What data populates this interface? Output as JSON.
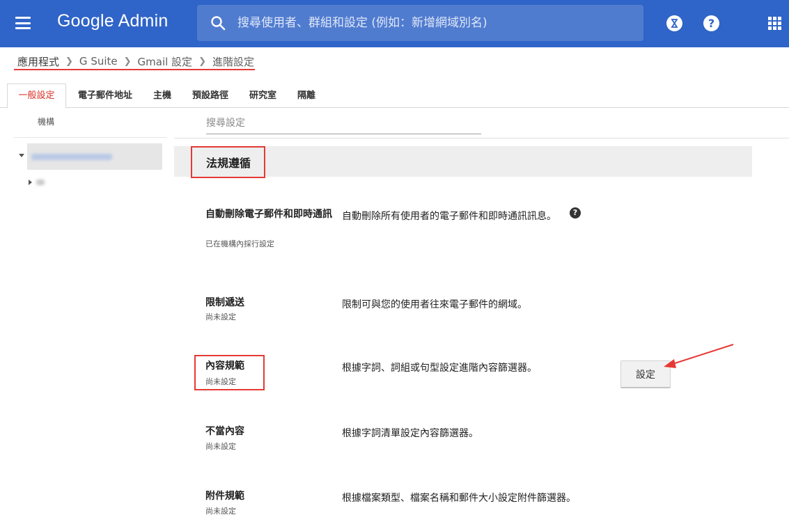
{
  "header": {
    "app_title": "Google Admin",
    "search_placeholder": "搜尋使用者、群組和設定 (例如：新增網域別名)",
    "icons": [
      "menu-icon",
      "search-icon",
      "hourglass-icon",
      "help-icon",
      "apps-grid-icon"
    ],
    "help_glyph": "?",
    "background_color": "#2f64c8"
  },
  "breadcrumb": [
    "應用程式",
    "G Suite",
    "Gmail 設定",
    "進階設定"
  ],
  "tabs": [
    {
      "label": "一般設定",
      "active": true
    },
    {
      "label": "電子郵件地址"
    },
    {
      "label": "主機"
    },
    {
      "label": "預設路徑"
    },
    {
      "label": "研究室"
    },
    {
      "label": "隔離"
    }
  ],
  "left_panel": {
    "heading": "機構",
    "tree": [
      {
        "label": "",
        "expanded": true,
        "selected": true,
        "blurred": true
      },
      {
        "label": "",
        "expanded": false,
        "blurred": true
      }
    ]
  },
  "content": {
    "search_placeholder": "搜尋設定",
    "section_title": "法規遵循",
    "settings": [
      {
        "name": "自動刪除電子郵件和即時通訊",
        "status": "已在機構內採行設定",
        "description": "自動刪除所有使用者的電子郵件和即時通訊訊息。",
        "has_help": true
      },
      {
        "name": "限制遞送",
        "status": "尚未設定",
        "description": "限制可與您的使用者往來電子郵件的網域。"
      },
      {
        "name": "內容規範",
        "status": "尚未設定",
        "description": "根據字詞、詞組或句型設定進階內容篩選器。",
        "button_label": "設定"
      },
      {
        "name": "不當內容",
        "status": "尚未設定",
        "description": "根據字詞清單設定內容篩選器。"
      },
      {
        "name": "附件規範",
        "status": "尚未設定",
        "description": "根據檔案類型、檔案名稱和郵件大小設定附件篩選器。"
      }
    ]
  },
  "colors": {
    "annotation_red": "#e53935",
    "active_tab_red": "#d93025"
  }
}
